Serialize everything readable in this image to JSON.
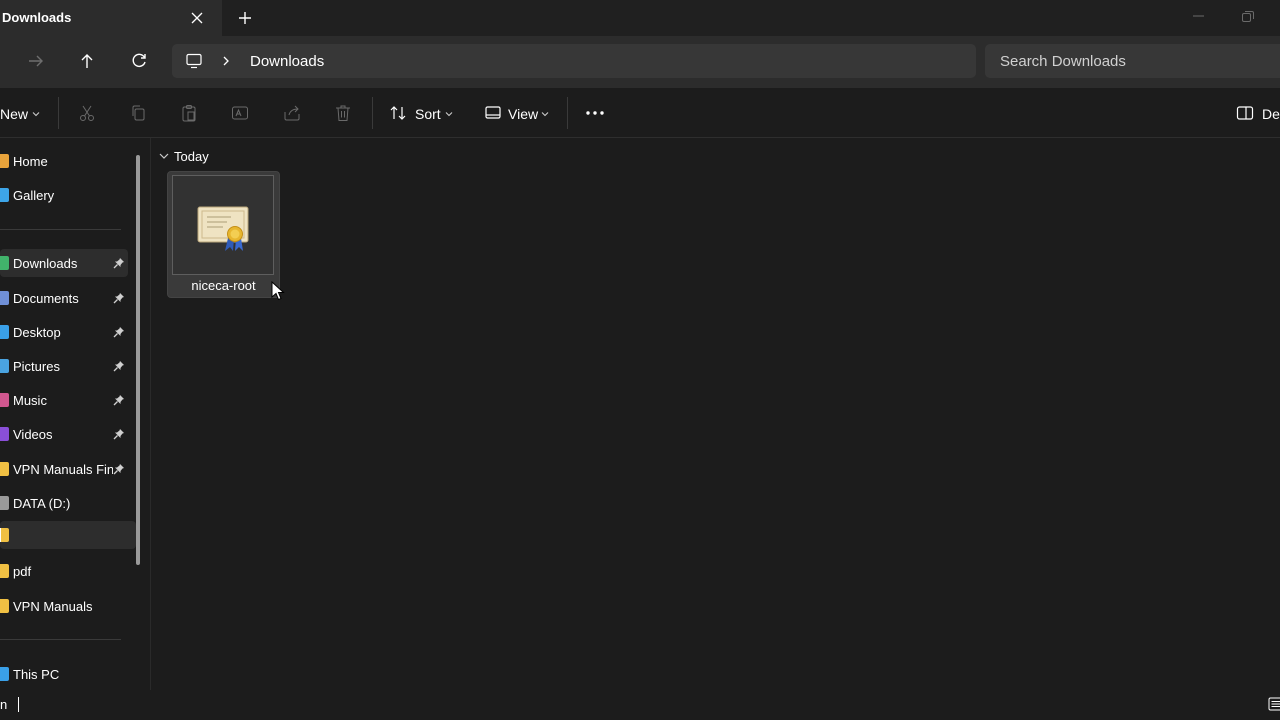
{
  "window": {
    "tab_title": "Downloads",
    "new_tab_label": "+"
  },
  "address": {
    "breadcrumb": "Downloads",
    "search_placeholder": "Search Downloads"
  },
  "toolbar": {
    "new_label": "New",
    "sort_label": "Sort",
    "view_label": "View",
    "details_label": "Det"
  },
  "sidebar": {
    "items": [
      {
        "label": "Home",
        "icon": "home-icon",
        "color": "#e8a33b",
        "pinned": false
      },
      {
        "label": "Gallery",
        "icon": "gallery-icon",
        "color": "#3da5e8",
        "pinned": false
      },
      {
        "label": "Downloads",
        "icon": "download-icon",
        "color": "#41b36b",
        "pinned": true,
        "selected": true
      },
      {
        "label": "Documents",
        "icon": "documents-icon",
        "color": "#6f8fd6",
        "pinned": true
      },
      {
        "label": "Desktop",
        "icon": "desktop-icon",
        "color": "#3aa0e8",
        "pinned": true
      },
      {
        "label": "Pictures",
        "icon": "pictures-icon",
        "color": "#4aa3e0",
        "pinned": true
      },
      {
        "label": "Music",
        "icon": "music-icon",
        "color": "#d1578f",
        "pinned": true
      },
      {
        "label": "Videos",
        "icon": "videos-icon",
        "color": "#8a4fd8",
        "pinned": true
      },
      {
        "label": "VPN Manuals Fina",
        "icon": "folder-icon",
        "color": "#f0c043",
        "pinned": true
      },
      {
        "label": "DATA (D:)",
        "icon": "drive-icon",
        "color": "#9a9a9a",
        "pinned": false
      },
      {
        "label": "",
        "icon": "folder-icon",
        "color": "#f0c043",
        "pinned": false,
        "editing": true
      },
      {
        "label": "pdf",
        "icon": "folder-icon",
        "color": "#f0c043",
        "pinned": false
      },
      {
        "label": "VPN Manuals",
        "icon": "folder-icon",
        "color": "#f0c043",
        "pinned": false
      },
      {
        "label": "This PC",
        "icon": "this-pc-icon",
        "color": "#3aa0e8",
        "pinned": false
      }
    ]
  },
  "content": {
    "group_label": "Today",
    "files": [
      {
        "name": "niceca-root",
        "icon": "certificate-icon"
      }
    ]
  },
  "statusbar": {
    "text": "n"
  },
  "colors": {
    "background": "#1c1c1c",
    "titlebar": "#202020",
    "address_row": "#2c2c2c",
    "field": "#373737",
    "selected": "#2d2d2d"
  }
}
